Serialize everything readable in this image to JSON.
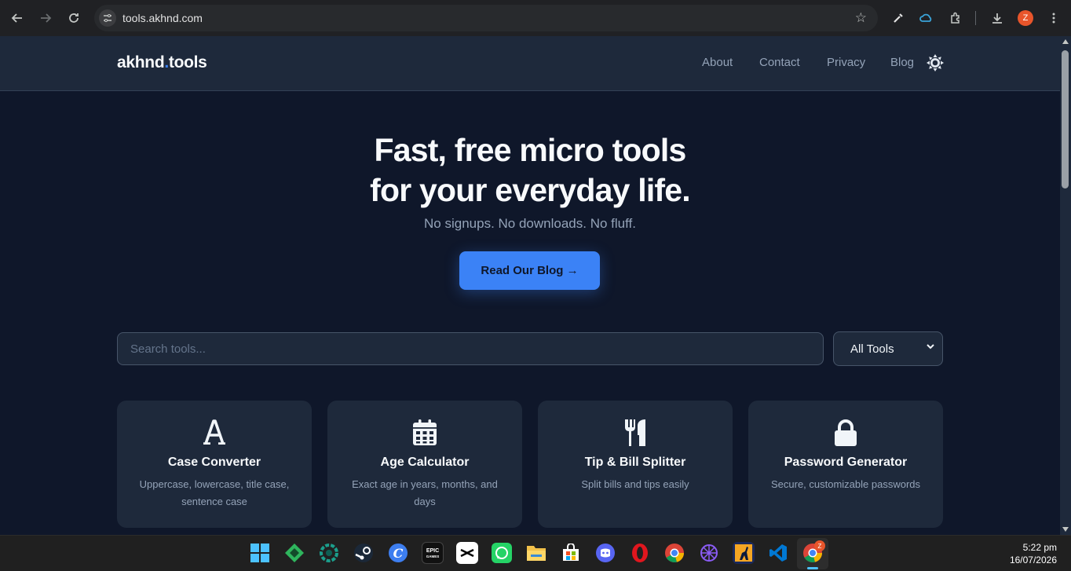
{
  "browser": {
    "url": "tools.akhnd.com",
    "avatar_letter": "Z"
  },
  "site": {
    "logo_prefix": "akhnd",
    "logo_dot": ".",
    "logo_suffix": "tools",
    "nav": [
      "About",
      "Contact",
      "Privacy",
      "Blog"
    ]
  },
  "hero": {
    "title_line1": "Fast, free micro tools",
    "title_line2": "for your everyday life.",
    "subtitle": "No signups. No downloads. No fluff.",
    "cta_label": "Read Our Blog →"
  },
  "search": {
    "placeholder": "Search tools...",
    "filter_value": "All Tools"
  },
  "tools": [
    {
      "icon": "font-icon",
      "title": "Case Converter",
      "desc": "Uppercase, lowercase, title case, sentence case"
    },
    {
      "icon": "calendar-icon",
      "title": "Age Calculator",
      "desc": "Exact age in years, months, and days"
    },
    {
      "icon": "utensils-icon",
      "title": "Tip & Bill Splitter",
      "desc": "Split bills and tips easily"
    },
    {
      "icon": "lock-icon",
      "title": "Password Generator",
      "desc": "Secure, customizable passwords"
    }
  ],
  "taskbar": {
    "time": "5:22 pm",
    "date": "16/07/2026",
    "chrome_badge": "Z"
  },
  "colors": {
    "accent": "#3b82f6",
    "background": "#0f172a",
    "card": "#1e293b"
  }
}
